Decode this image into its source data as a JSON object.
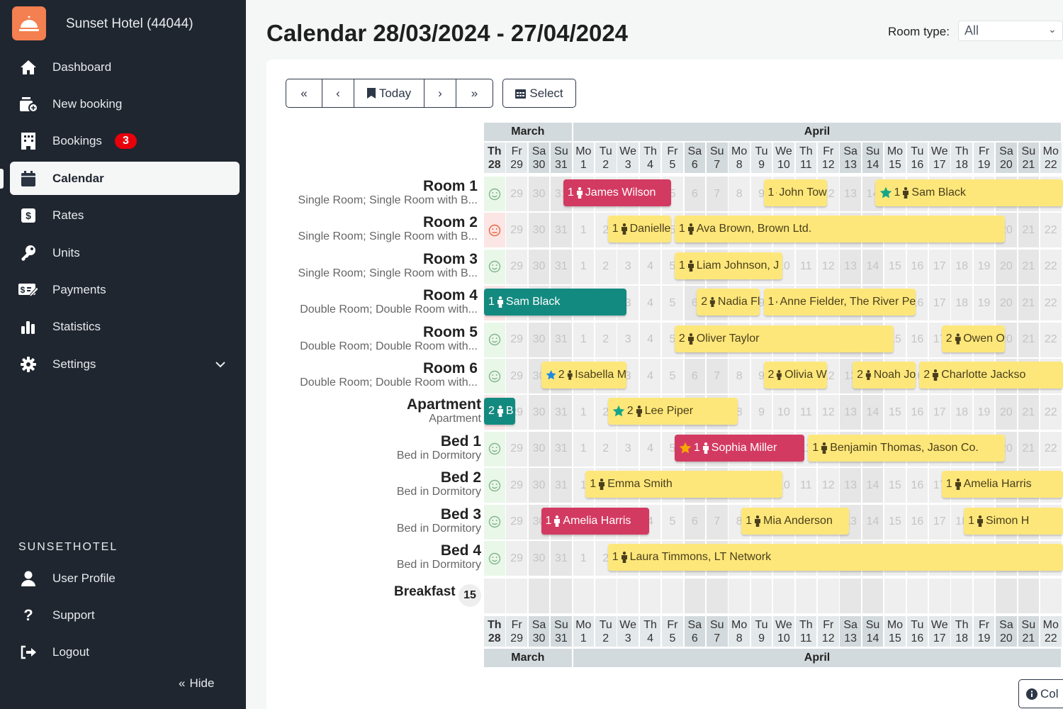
{
  "sidebar": {
    "hotel_name": "Sunset Hotel (44044)",
    "logo_icon": "concierge-bell-icon",
    "items": [
      {
        "label": "Dashboard",
        "icon": "home-icon"
      },
      {
        "label": "New booking",
        "icon": "new-booking-icon"
      },
      {
        "label": "Bookings",
        "icon": "building-icon",
        "badge": "3"
      },
      {
        "label": "Calendar",
        "icon": "calendar-icon",
        "active": true
      },
      {
        "label": "Rates",
        "icon": "dollar-icon"
      },
      {
        "label": "Units",
        "icon": "key-icon"
      },
      {
        "label": "Payments",
        "icon": "payment-check-icon"
      },
      {
        "label": "Statistics",
        "icon": "bar-chart-icon"
      },
      {
        "label": "Settings",
        "icon": "gear-icon"
      }
    ],
    "section_title": "SUNSETHOTEL",
    "bottom_items": [
      {
        "label": "User Profile",
        "icon": "user-icon"
      },
      {
        "label": "Support",
        "icon": "question-icon"
      },
      {
        "label": "Logout",
        "icon": "logout-icon"
      }
    ],
    "hide_label": "Hide"
  },
  "header": {
    "title": "Calendar 28/03/2024 - 27/04/2024",
    "room_type_label": "Room type:",
    "room_type_value": "All"
  },
  "toolbar": {
    "today_label": "Today",
    "select_label": "Select"
  },
  "colors": {
    "accent": "#f47f50",
    "yellow": "#fee77a",
    "red": "#d33a61",
    "teal": "#138a80",
    "star_teal": "#17a589",
    "star_blue": "#1e88e5",
    "star_orange": "#f5a800"
  },
  "months": [
    {
      "label": "March",
      "days": 4
    },
    {
      "label": "April",
      "days": 22
    }
  ],
  "days": [
    {
      "wd": "Th",
      "d": "28",
      "date": "2024-03-28"
    },
    {
      "wd": "Fr",
      "d": "29",
      "date": "2024-03-29"
    },
    {
      "wd": "Sa",
      "d": "30",
      "date": "2024-03-30"
    },
    {
      "wd": "Su",
      "d": "31",
      "date": "2024-03-31"
    },
    {
      "wd": "Mo",
      "d": "1",
      "date": "2024-04-01"
    },
    {
      "wd": "Tu",
      "d": "2",
      "date": "2024-04-02"
    },
    {
      "wd": "We",
      "d": "3",
      "date": "2024-04-03"
    },
    {
      "wd": "Th",
      "d": "4",
      "date": "2024-04-04"
    },
    {
      "wd": "Fr",
      "d": "5",
      "date": "2024-04-05"
    },
    {
      "wd": "Sa",
      "d": "6",
      "date": "2024-04-06"
    },
    {
      "wd": "Su",
      "d": "7",
      "date": "2024-04-07"
    },
    {
      "wd": "Mo",
      "d": "8",
      "date": "2024-04-08"
    },
    {
      "wd": "Tu",
      "d": "9",
      "date": "2024-04-09"
    },
    {
      "wd": "We",
      "d": "10",
      "date": "2024-04-10"
    },
    {
      "wd": "Th",
      "d": "11",
      "date": "2024-04-11"
    },
    {
      "wd": "Fr",
      "d": "12",
      "date": "2024-04-12"
    },
    {
      "wd": "Sa",
      "d": "13",
      "date": "2024-04-13"
    },
    {
      "wd": "Su",
      "d": "14",
      "date": "2024-04-14"
    },
    {
      "wd": "Mo",
      "d": "15",
      "date": "2024-04-15"
    },
    {
      "wd": "Tu",
      "d": "16",
      "date": "2024-04-16"
    },
    {
      "wd": "We",
      "d": "17",
      "date": "2024-04-17"
    },
    {
      "wd": "Th",
      "d": "18",
      "date": "2024-04-18"
    },
    {
      "wd": "Fr",
      "d": "19",
      "date": "2024-04-19"
    },
    {
      "wd": "Sa",
      "d": "20",
      "date": "2024-04-20"
    },
    {
      "wd": "Su",
      "d": "21",
      "date": "2024-04-21"
    },
    {
      "wd": "Mo",
      "d": "22",
      "date": "2024-04-22"
    }
  ],
  "units": [
    {
      "name": "Room 1",
      "desc": "Single Room; Single Room with B...",
      "status": "clean",
      "bookings": [
        {
          "guests": "1",
          "name": "James Wilson",
          "color": "red",
          "start": "2024-03-31",
          "end": "2024-04-05"
        },
        {
          "guests": "1",
          "name": "John Tow",
          "color": "yellow",
          "start": "2024-04-09",
          "end": "2024-04-12"
        },
        {
          "guests": "1",
          "name": "Sam Black",
          "color": "yellow",
          "star": "star_teal",
          "start": "2024-04-14",
          "end": null
        }
      ]
    },
    {
      "name": "Room 2",
      "desc": "Single Room; Single Room with B...",
      "status": "dirty",
      "bookings": [
        {
          "guests": "1",
          "name": "Danielle",
          "color": "yellow",
          "start": "2024-04-02",
          "end": "2024-04-05"
        },
        {
          "guests": "1",
          "name": "Ava Brown, Brown Ltd.",
          "color": "yellow",
          "start": "2024-04-05",
          "end": "2024-04-20"
        }
      ]
    },
    {
      "name": "Room 3",
      "desc": "Single Room; Single Room with B...",
      "status": "clean",
      "bookings": [
        {
          "guests": "1",
          "name": "Liam Johnson, J",
          "color": "yellow",
          "start": "2024-04-05",
          "end": "2024-04-10"
        }
      ]
    },
    {
      "name": "Room 4",
      "desc": "Double Room; Double Room with...",
      "status": "dirty",
      "bookings": [
        {
          "guests": "1",
          "name": "Sam Black",
          "color": "teal",
          "start": null,
          "end": "2024-04-03"
        },
        {
          "guests": "2",
          "name": "Nadia Fl",
          "color": "yellow",
          "start": "2024-04-06",
          "end": "2024-04-09"
        },
        {
          "guests": "1",
          "name": "Anne Fielder, The River Pe",
          "color": "yellow",
          "start": "2024-04-09",
          "end": "2024-04-16"
        }
      ]
    },
    {
      "name": "Room 5",
      "desc": "Double Room; Double Room with...",
      "status": "clean",
      "bookings": [
        {
          "guests": "2",
          "name": "Oliver Taylor",
          "color": "yellow",
          "start": "2024-04-05",
          "end": "2024-04-15"
        },
        {
          "guests": "2",
          "name": "Owen O",
          "color": "yellow",
          "start": "2024-04-17",
          "end": "2024-04-20"
        }
      ]
    },
    {
      "name": "Room 6",
      "desc": "Double Room; Double Room with...",
      "status": "clean",
      "bookings": [
        {
          "guests": "2",
          "name": "Isabella M",
          "color": "yellow",
          "star": "star_blue",
          "start": "2024-03-30",
          "end": "2024-04-03"
        },
        {
          "guests": "2",
          "name": "Olivia W",
          "color": "yellow",
          "start": "2024-04-09",
          "end": "2024-04-12"
        },
        {
          "guests": "2",
          "name": "Noah Jo",
          "color": "yellow",
          "start": "2024-04-13",
          "end": "2024-04-16"
        },
        {
          "guests": "2",
          "name": "Charlotte Jackso",
          "color": "yellow",
          "start": "2024-04-16",
          "end": null
        }
      ]
    },
    {
      "name": "Apartment",
      "desc": "Apartment",
      "status": "dirty",
      "bookings": [
        {
          "guests": "2",
          "name": "B",
          "color": "teal",
          "start": null,
          "end": "2024-03-29"
        },
        {
          "guests": "2",
          "name": "Lee Piper",
          "color": "yellow",
          "star": "star_teal",
          "start": "2024-04-02",
          "end": "2024-04-08"
        }
      ]
    },
    {
      "name": "Bed 1",
      "desc": "Bed in Dormitory",
      "status": "clean",
      "bookings": [
        {
          "guests": "1",
          "name": "Sophia Miller",
          "color": "red",
          "star": "star_orange",
          "start": "2024-04-05",
          "end": "2024-04-11"
        },
        {
          "guests": "1",
          "name": "Benjamin Thomas, Jason Co.",
          "color": "yellow",
          "start": "2024-04-11",
          "end": "2024-04-20"
        }
      ]
    },
    {
      "name": "Bed 2",
      "desc": "Bed in Dormitory",
      "status": "clean",
      "bookings": [
        {
          "guests": "1",
          "name": "Emma Smith",
          "color": "yellow",
          "start": "2024-04-01",
          "end": "2024-04-10"
        },
        {
          "guests": "1",
          "name": "Amelia Harris",
          "color": "yellow",
          "start": "2024-04-17",
          "end": null
        }
      ]
    },
    {
      "name": "Bed 3",
      "desc": "Bed in Dormitory",
      "status": "clean",
      "bookings": [
        {
          "guests": "1",
          "name": "Amelia Harris",
          "color": "red",
          "start": "2024-03-30",
          "end": "2024-04-04"
        },
        {
          "guests": "1",
          "name": "Mia Anderson",
          "color": "yellow",
          "start": "2024-04-08",
          "end": "2024-04-13"
        },
        {
          "guests": "1",
          "name": "Simon H",
          "color": "yellow",
          "start": "2024-04-18",
          "end": null
        }
      ]
    },
    {
      "name": "Bed 4",
      "desc": "Bed in Dormitory",
      "status": "clean",
      "bookings": [
        {
          "guests": "1",
          "name": "Laura Timmons, LT Network",
          "color": "yellow",
          "start": "2024-04-02",
          "end": null
        }
      ]
    }
  ],
  "breakfast": {
    "label": "Breakfast",
    "count": "15"
  },
  "footer_button": {
    "label": "Col",
    "icon": "info-icon"
  }
}
